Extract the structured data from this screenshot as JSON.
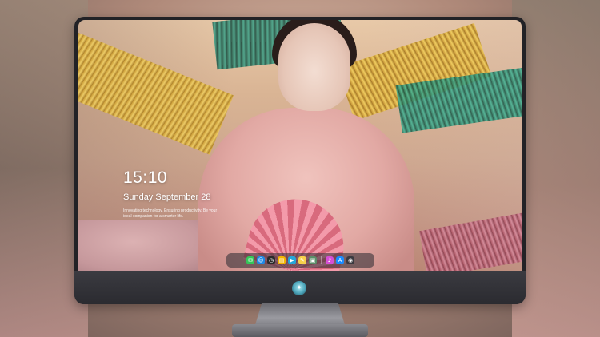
{
  "lockscreen": {
    "time": "15:10",
    "date": "Sunday September 28",
    "tagline": "Innovating technology. Ensuring productivity. Be your ideal companion for a smarter life."
  },
  "dock": {
    "apps": [
      {
        "name": "messages",
        "glyph": "✉",
        "color": "#34c759"
      },
      {
        "name": "finder",
        "glyph": "☺",
        "color": "#1e88e5"
      },
      {
        "name": "clock",
        "glyph": "◷",
        "color": "#2b2b2b"
      },
      {
        "name": "gallery",
        "glyph": "▤",
        "color": "#f4b400"
      },
      {
        "name": "video",
        "glyph": "▶",
        "color": "#26a6d9"
      },
      {
        "name": "notes",
        "glyph": "✎",
        "color": "#f7d04b"
      },
      {
        "name": "photos",
        "glyph": "▣",
        "color": "#5c8f6a"
      },
      {
        "name": "music",
        "glyph": "♪",
        "color": "#d64fd6"
      },
      {
        "name": "app-store",
        "glyph": "A",
        "color": "#1a8cff"
      },
      {
        "name": "camera",
        "glyph": "◉",
        "color": "#3a3a40"
      }
    ]
  },
  "monitor": {
    "logo_glyph": "✦"
  }
}
